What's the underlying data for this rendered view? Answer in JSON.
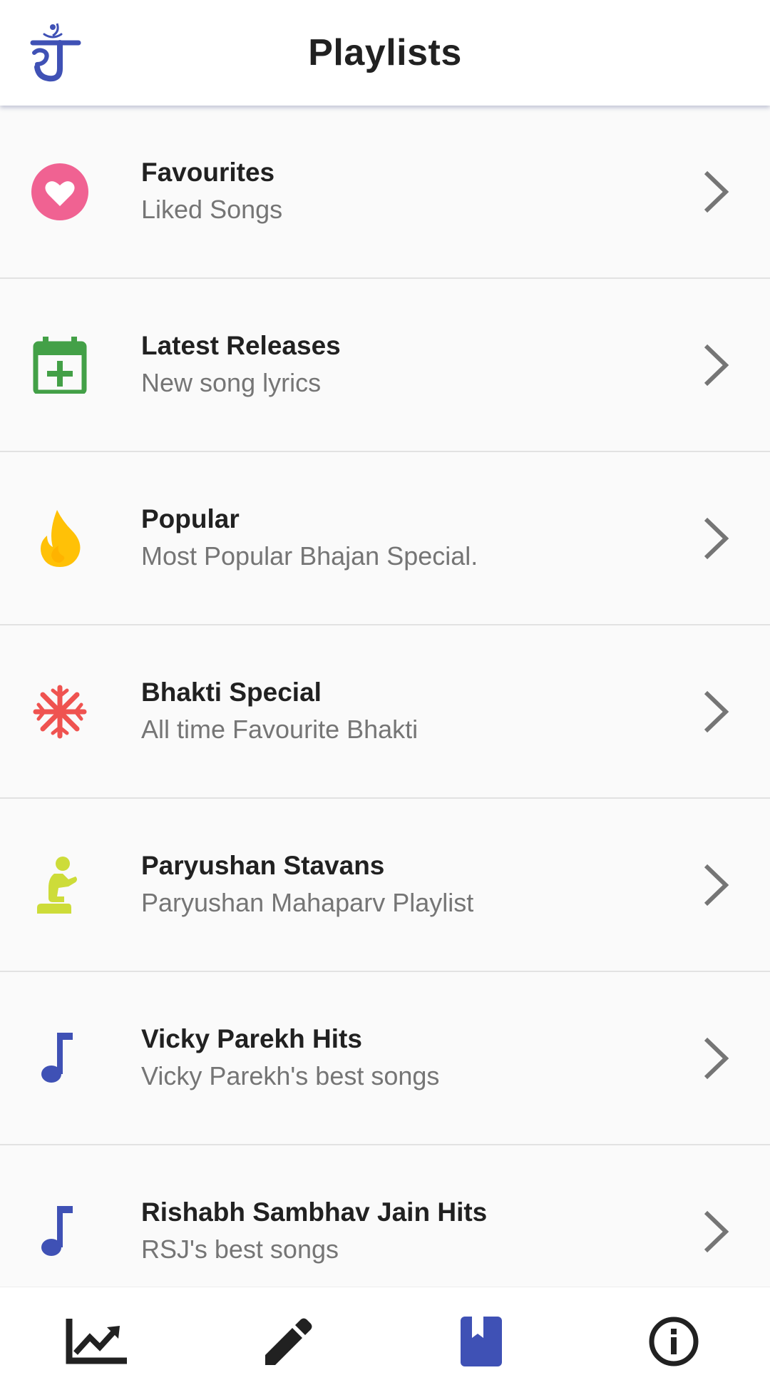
{
  "header": {
    "title": "Playlists",
    "logo_icon": "jain-logo-icon",
    "logo_color": "#3f51b5"
  },
  "playlists": [
    {
      "title": "Favourites",
      "subtitle": "Liked Songs",
      "icon": "heart-circle-icon",
      "color": "#f06292"
    },
    {
      "title": "Latest Releases",
      "subtitle": "New song lyrics",
      "icon": "calendar-plus-icon",
      "color": "#43a047"
    },
    {
      "title": "Popular",
      "subtitle": "Most Popular Bhajan Special.",
      "icon": "fire-icon",
      "color": "#ffc107"
    },
    {
      "title": "Bhakti Special",
      "subtitle": "All time Favourite Bhakti",
      "icon": "snowflake-icon",
      "color": "#ef5350"
    },
    {
      "title": "Paryushan Stavans",
      "subtitle": "Paryushan Mahaparv Playlist",
      "icon": "praying-person-icon",
      "color": "#cddc39"
    },
    {
      "title": "Vicky Parekh Hits",
      "subtitle": "Vicky Parekh's best songs",
      "icon": "music-note-icon",
      "color": "#3f51b5"
    },
    {
      "title": "Rishabh Sambhav Jain Hits",
      "subtitle": "RSJ's best songs",
      "icon": "music-note-icon",
      "color": "#3f51b5"
    }
  ],
  "bottom_nav": {
    "items": [
      {
        "icon": "trending-chart-icon",
        "active": false
      },
      {
        "icon": "pencil-icon",
        "active": false
      },
      {
        "icon": "book-icon",
        "active": true
      },
      {
        "icon": "info-icon",
        "active": false
      }
    ],
    "active_color": "#3f51b5",
    "inactive_color": "#212121"
  }
}
